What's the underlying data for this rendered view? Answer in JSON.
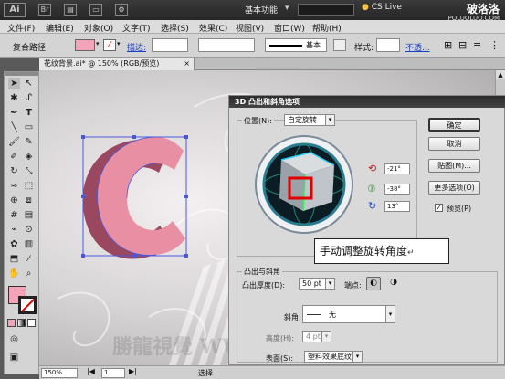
{
  "titlebar": {
    "logo": "Ai",
    "icons": [
      "Br",
      "▤",
      "▭",
      "⚙"
    ],
    "workspace": "基本功能",
    "cslive": "CS Live",
    "watermark": "破洛洛",
    "watermark_url": "POLUOLUO.COM"
  },
  "menu": [
    "文件(F)",
    "编辑(E)",
    "对象(O)",
    "文字(T)",
    "选择(S)",
    "效果(C)",
    "视图(V)",
    "窗口(W)",
    "帮助(H)"
  ],
  "control": {
    "mode": "复合路径",
    "stroke_label": "描边:",
    "basic": "基本",
    "style_label": "样式:",
    "opacity": "不透..."
  },
  "document_tab": "花纹背景.ai* @ 150% (RGB/预览)",
  "canvas_watermark": "勝龍視覺 WWW.TLVI.NET",
  "status": {
    "zoom": "150%",
    "page": "1",
    "tool": "选择"
  },
  "dialog": {
    "title": "3D 凸出和斜角选项",
    "position_label": "位置(N):",
    "position_value": "自定旋转",
    "angles": [
      "-21°",
      "-38°",
      "13°"
    ],
    "buttons": {
      "ok": "确定",
      "cancel": "取消",
      "map": "贴图(M)...",
      "more": "更多选项(O)",
      "preview": "预览(P)"
    },
    "preview_checked": true,
    "extrude_section": "凸出与斜角",
    "depth_label": "凸出厚度(D):",
    "depth_value": "50 pt",
    "cap_label": "端点:",
    "bevel_label": "斜角:",
    "bevel_value": "无",
    "height_label": "高度(H):",
    "height_value": "4 pt",
    "surface_label": "表面(S):",
    "surface_value": "塑料效果底纹"
  },
  "callout": "手动调整旋转角度",
  "colors": {
    "fill": "#f4a3b9",
    "letter_front": "#e98fa3",
    "letter_side": "#9a4760",
    "selection": "#4858d8",
    "highlight": "#e10000"
  }
}
